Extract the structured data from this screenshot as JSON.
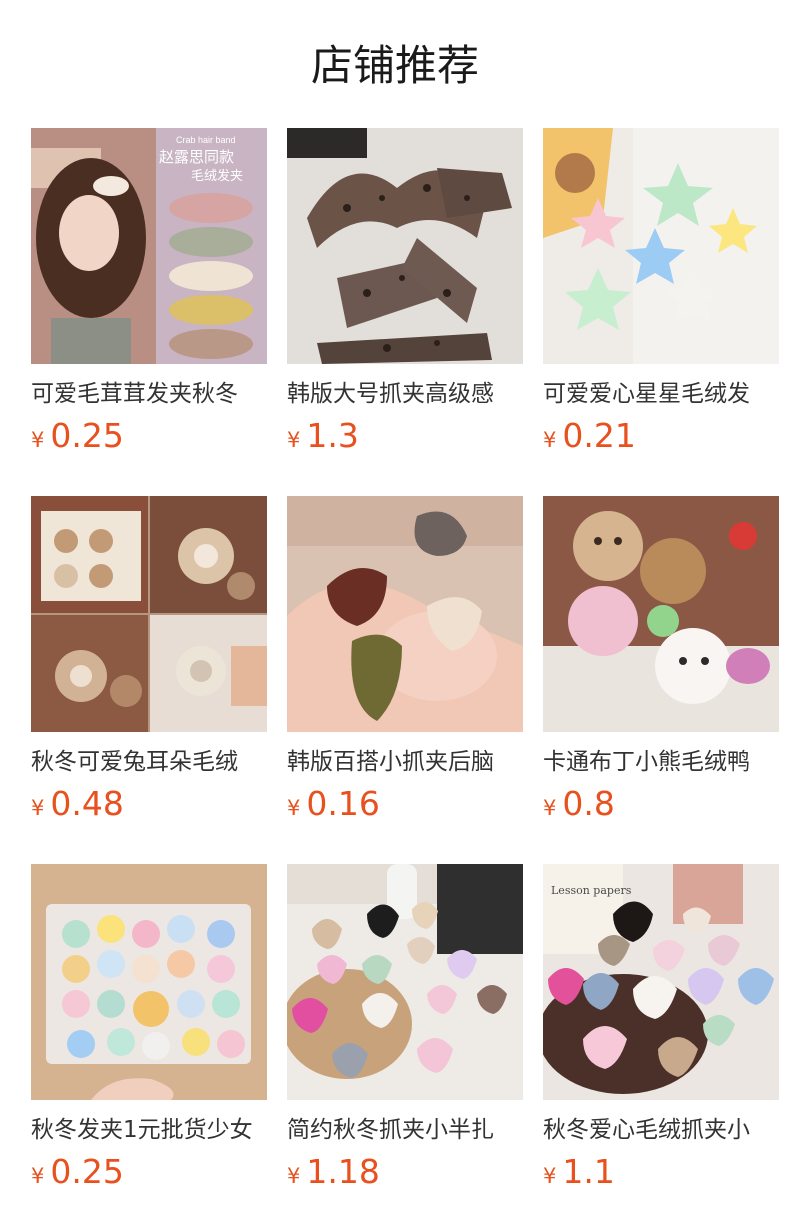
{
  "page": {
    "title": "店铺推荐"
  },
  "products": [
    {
      "name": "可爱毛茸茸发夹秋冬",
      "currency": "¥",
      "price": "0.25",
      "banner_line1": "Crab hair band",
      "banner_line2": "赵露思同款",
      "banner_line3": "毛绒发夹"
    },
    {
      "name": "韩版大号抓夹高级感",
      "currency": "¥",
      "price": "1.3"
    },
    {
      "name": "可爱爱心星星毛绒发",
      "currency": "¥",
      "price": "0.21"
    },
    {
      "name": "秋冬可爱兔耳朵毛绒",
      "currency": "¥",
      "price": "0.48"
    },
    {
      "name": "韩版百搭小抓夹后脑",
      "currency": "¥",
      "price": "0.16"
    },
    {
      "name": "卡通布丁小熊毛绒鸭",
      "currency": "¥",
      "price": "0.8"
    },
    {
      "name": "秋冬发夹1元批货少女",
      "currency": "¥",
      "price": "0.25"
    },
    {
      "name": "简约秋冬抓夹小半扎",
      "currency": "¥",
      "price": "1.18"
    },
    {
      "name": "秋冬爱心毛绒抓夹小",
      "currency": "¥",
      "price": "1.1",
      "card_text": "Lesson papers"
    }
  ]
}
